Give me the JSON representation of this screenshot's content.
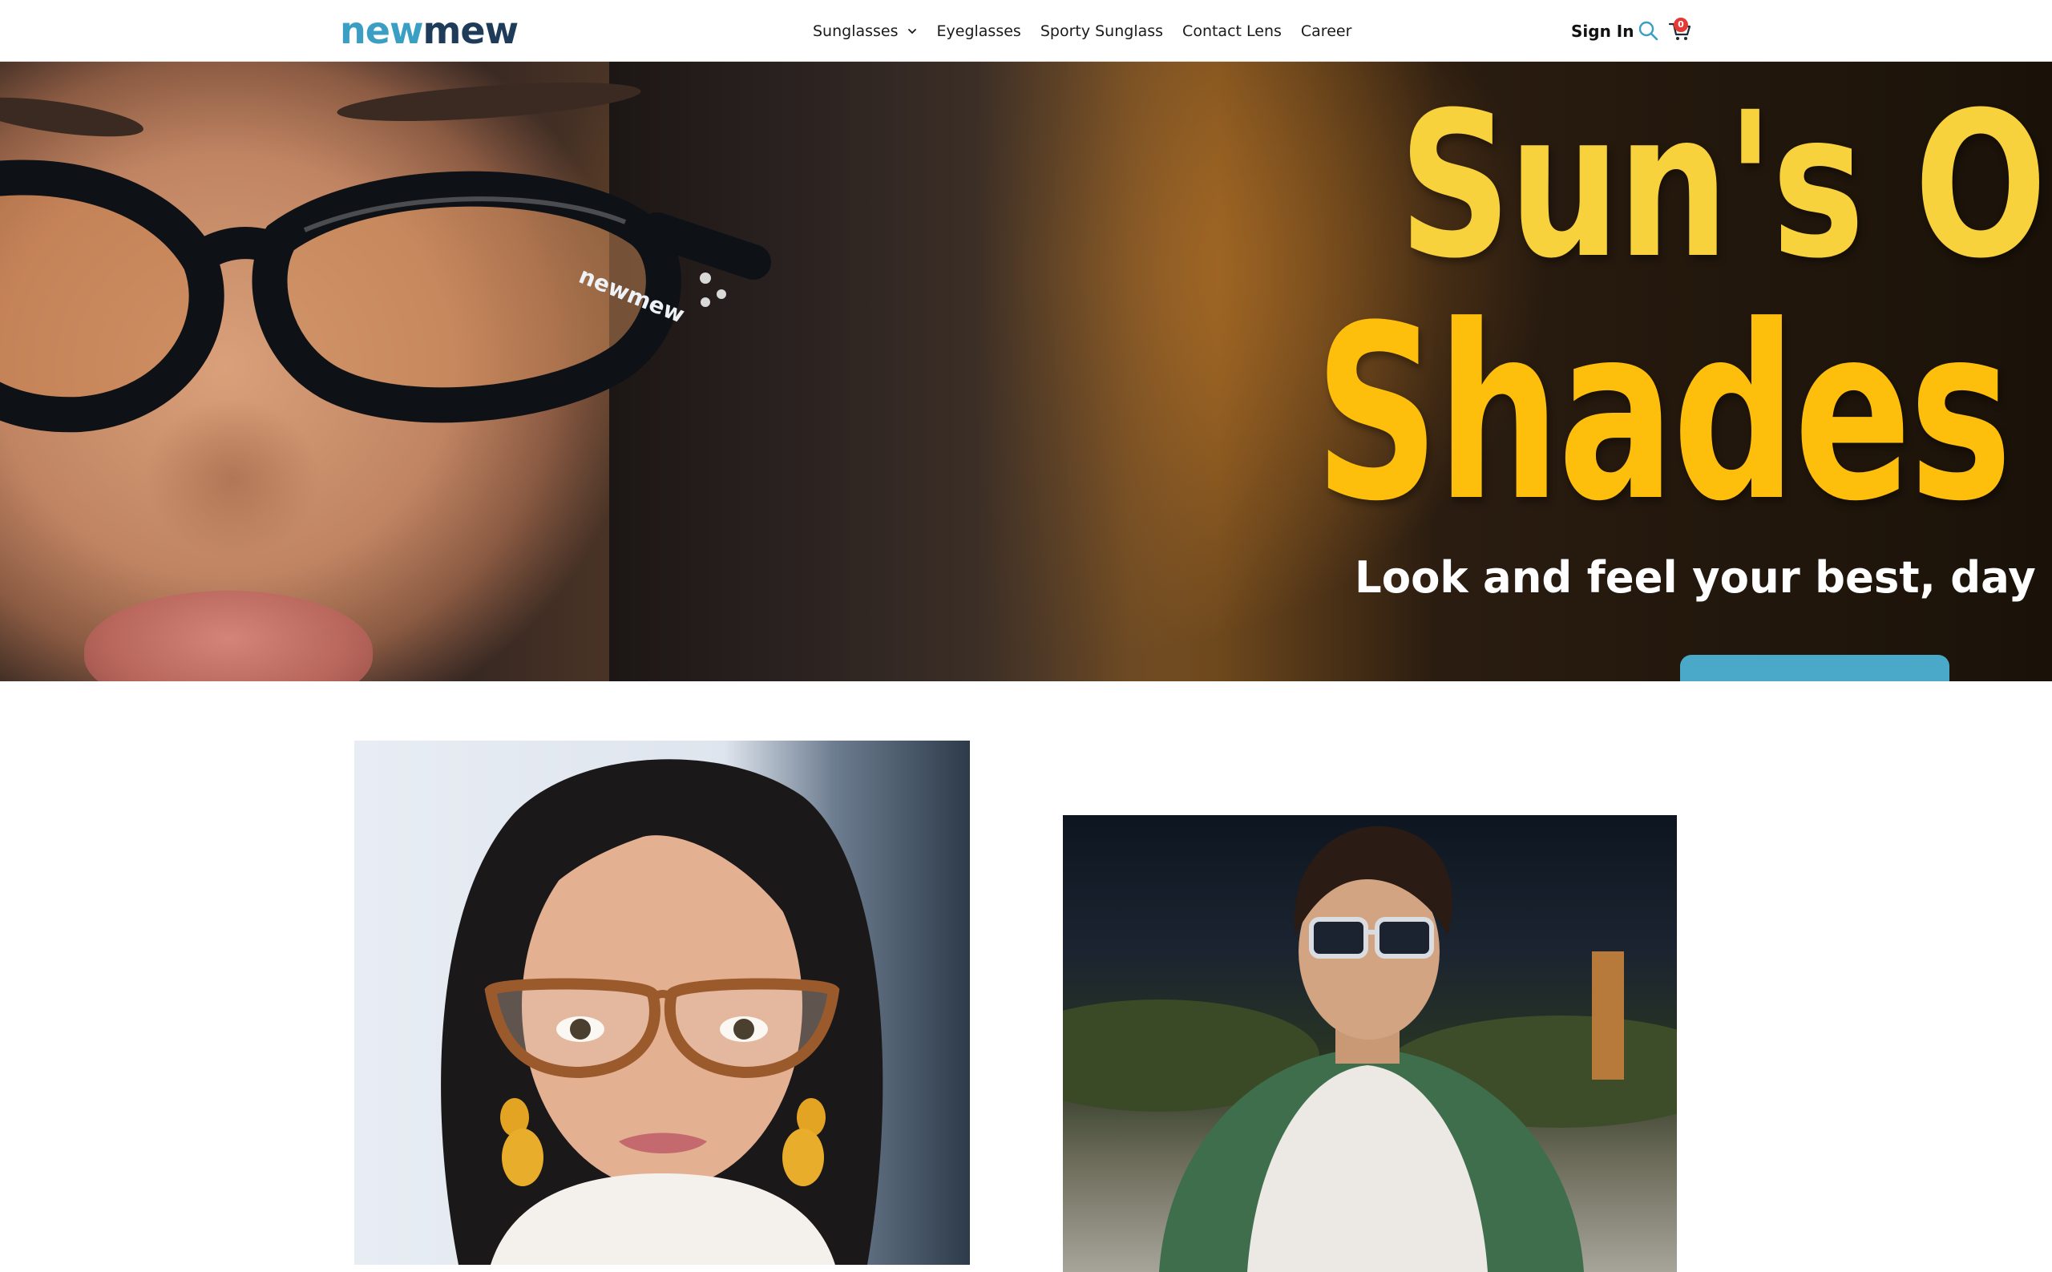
{
  "header": {
    "logo": {
      "part_a": "new",
      "part_b": "mew"
    },
    "nav": [
      {
        "label": "Sunglasses",
        "has_dropdown": true
      },
      {
        "label": "Eyeglasses"
      },
      {
        "label": "Sporty Sunglass"
      },
      {
        "label": "Contact Lens"
      },
      {
        "label": "Career"
      }
    ],
    "sign_in": "Sign In",
    "search_icon": "search-icon",
    "cart_icon": "cart-icon",
    "cart_count": "0"
  },
  "hero": {
    "headline_line1": "Sun's O",
    "headline_line2": "Shades C",
    "subtitle": "Look and feel your best, day in an",
    "frame_brand": "newmew",
    "colors": {
      "headline_top": "#f7d23c",
      "headline_bottom": "#fdbf0b",
      "button": "#4aa8c8"
    }
  },
  "colors": {
    "logo_new": "#3a9fc2",
    "logo_mew": "#1e3c5a",
    "cart_badge": "#e53935"
  }
}
